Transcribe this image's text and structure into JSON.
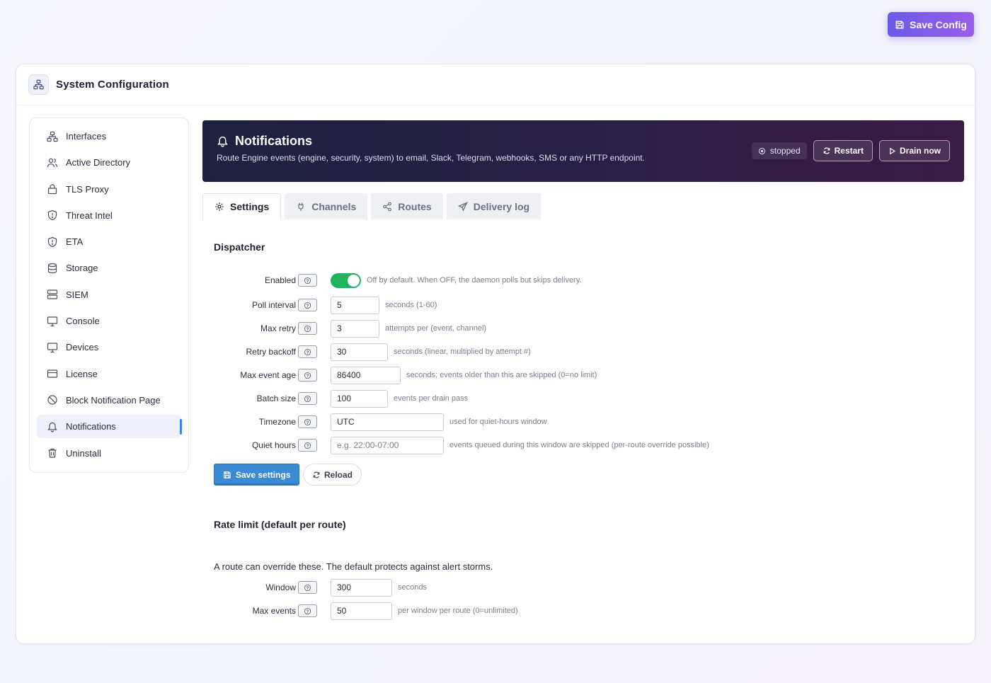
{
  "toolbar": {
    "save_config_label": "Save Config"
  },
  "header": {
    "title": "System Configuration"
  },
  "sidebar": {
    "items": [
      {
        "label": "Interfaces",
        "icon": "network-icon"
      },
      {
        "label": "Active Directory",
        "icon": "users-icon"
      },
      {
        "label": "TLS Proxy",
        "icon": "lock-icon"
      },
      {
        "label": "Threat Intel",
        "icon": "shield-alert-icon"
      },
      {
        "label": "ETA",
        "icon": "shield-alert-icon"
      },
      {
        "label": "Storage",
        "icon": "database-icon"
      },
      {
        "label": "SIEM",
        "icon": "server-icon"
      },
      {
        "label": "Console",
        "icon": "monitor-icon"
      },
      {
        "label": "Devices",
        "icon": "monitor-icon"
      },
      {
        "label": "License",
        "icon": "credit-card-icon"
      },
      {
        "label": "Block Notification Page",
        "icon": "ban-icon"
      },
      {
        "label": "Notifications",
        "icon": "bell-icon",
        "active": true
      },
      {
        "label": "Uninstall",
        "icon": "trash-icon"
      }
    ]
  },
  "banner": {
    "title": "Notifications",
    "subtitle": "Route Engine events (engine, security, system) to email, Slack, Telegram, webhooks, SMS or any HTTP endpoint.",
    "status": "stopped",
    "restart_label": "Restart",
    "drain_label": "Drain now"
  },
  "tabs": [
    {
      "label": "Settings",
      "active": true
    },
    {
      "label": "Channels"
    },
    {
      "label": "Routes"
    },
    {
      "label": "Delivery log"
    }
  ],
  "dispatcher": {
    "title": "Dispatcher",
    "enabled": {
      "label": "Enabled",
      "value": true,
      "hint": "Off by default. When OFF, the daemon polls but skips delivery."
    },
    "poll_interval": {
      "label": "Poll interval",
      "value": "5",
      "hint": "seconds (1-60)"
    },
    "max_retry": {
      "label": "Max retry",
      "value": "3",
      "hint": "attempts per (event, channel)"
    },
    "retry_backoff": {
      "label": "Retry backoff",
      "value": "30",
      "hint": "seconds (linear, multiplied by attempt #)"
    },
    "max_event_age": {
      "label": "Max event age",
      "value": "86400",
      "hint": "seconds; events older than this are skipped (0=no limit)"
    },
    "batch_size": {
      "label": "Batch size",
      "value": "100",
      "hint": "events per drain pass"
    },
    "timezone": {
      "label": "Timezone",
      "value": "UTC",
      "hint": "used for quiet-hours window"
    },
    "quiet_hours": {
      "label": "Quiet hours",
      "value": "",
      "placeholder": "e.g. 22:00-07:00",
      "hint": "events queued during this window are skipped (per-route override possible)"
    },
    "save_label": "Save settings",
    "reload_label": "Reload"
  },
  "rate_limit": {
    "title": "Rate limit (default per route)",
    "description": "A route can override these. The default protects against alert storms.",
    "window": {
      "label": "Window",
      "value": "300",
      "hint": "seconds"
    },
    "max_events": {
      "label": "Max events",
      "value": "50",
      "hint": "per window per route (0=unlimited)"
    }
  },
  "colors": {
    "accent": "#3b8bd4",
    "toggle_on": "#22b35e",
    "brand_gradient_start": "#6b5ae6",
    "brand_gradient_end": "#9a5de8"
  }
}
